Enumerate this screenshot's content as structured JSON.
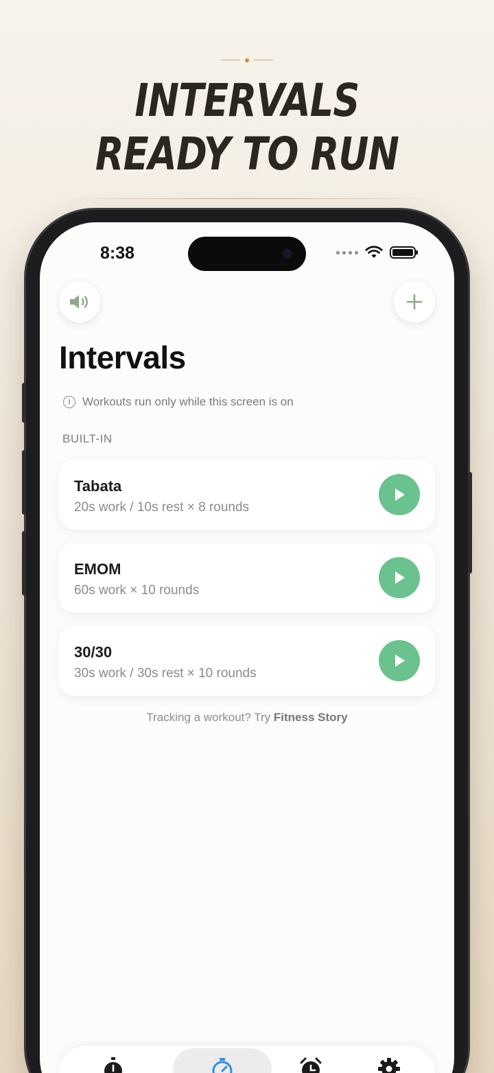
{
  "promo": {
    "headline_line1": "INTERVALS",
    "headline_line2": "READY TO RUN"
  },
  "status_bar": {
    "time": "8:38"
  },
  "header": {
    "sound_icon": "speaker-icon",
    "add_icon": "plus-icon"
  },
  "page": {
    "title": "Intervals",
    "notice": "Workouts run only while this screen is on",
    "section_label": "BUILT-IN"
  },
  "workouts": [
    {
      "name": "Tabata",
      "description": "20s work / 10s rest × 8 rounds"
    },
    {
      "name": "EMOM",
      "description": "60s work × 10 rounds"
    },
    {
      "name": "30/30",
      "description": "30s work / 30s rest × 10 rounds"
    }
  ],
  "footer": {
    "prefix": "Tracking a workout? Try ",
    "link": "Fitness Story"
  },
  "tabs": [
    {
      "icon": "stopwatch-icon",
      "active": false
    },
    {
      "icon": "interval-timer-icon",
      "active": true
    },
    {
      "icon": "alarm-clock-icon",
      "active": false
    },
    {
      "icon": "settings-gear-icon",
      "active": false
    }
  ],
  "colors": {
    "accent_green": "#6ac28e",
    "headline": "#2b2620",
    "active_tab_icon": "#2e8fe0",
    "ornament_dot": "#d98b3a"
  }
}
